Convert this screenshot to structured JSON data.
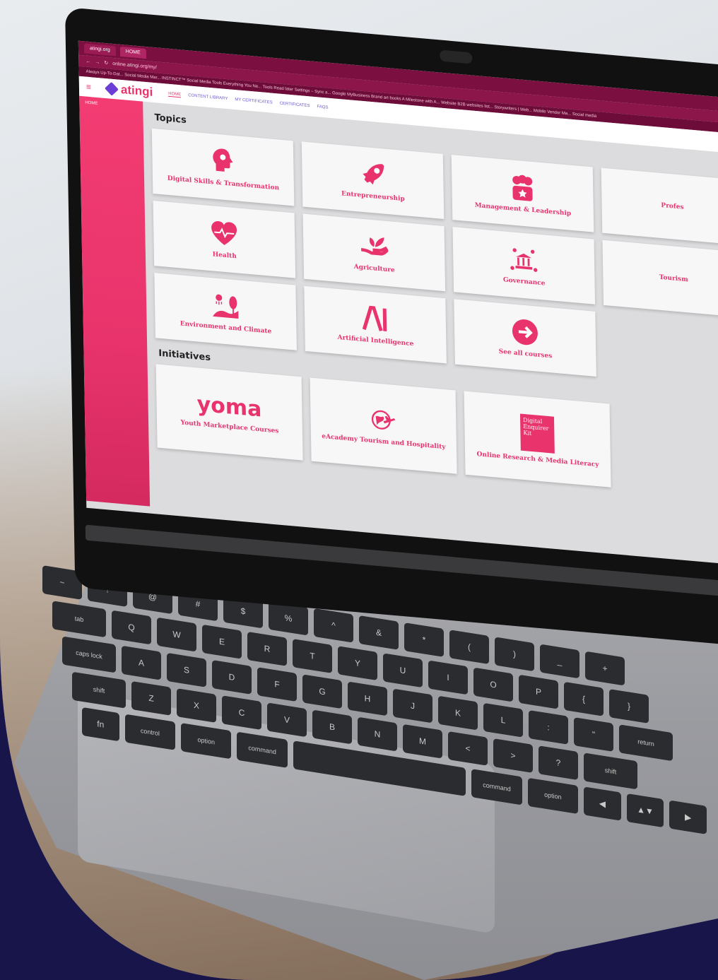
{
  "browser": {
    "tabs": [
      "atingi.org",
      "HOME"
    ],
    "url": "online.atingi.org/my/",
    "bookmarks": "Always Up-To-Dat...  Social Media Mar...  INSTINCT™  Social Media Tools  Everything You Ne...  Tools  Read later  Settings – Sync a...  Google MyBusiness  Brand art books  A Milestone with A...  Website  B2B websites list...  Storywriters | Web...  Mobile Vendor Ma...  Social media"
  },
  "app": {
    "brand": "atingi",
    "nav": [
      "HOME",
      "CONTENT LIBRARY",
      "MY CERTIFICATES",
      "CERTIFICATES",
      "FAQS"
    ],
    "sidebar_home": "HOME"
  },
  "topics": {
    "title": "Topics",
    "items": [
      {
        "label": "Digital Skills & Transformation",
        "icon": "brain-head-icon"
      },
      {
        "label": "Entrepreneurship",
        "icon": "rocket-icon"
      },
      {
        "label": "Management & Leadership",
        "icon": "team-star-icon"
      },
      {
        "label": "Profes",
        "icon": "partial-icon"
      },
      {
        "label": "Health",
        "icon": "heart-pulse-icon"
      },
      {
        "label": "Agriculture",
        "icon": "hand-plant-icon"
      },
      {
        "label": "Governance",
        "icon": "government-building-icon"
      },
      {
        "label": "Tourism",
        "icon": "partial-icon"
      },
      {
        "label": "Environment and Climate",
        "icon": "landscape-tree-icon"
      },
      {
        "label": "Artificial Intelligence",
        "icon": "ai-letters-icon"
      },
      {
        "label": "See all courses",
        "icon": "arrow-circle-icon"
      }
    ]
  },
  "initiatives": {
    "title": "Initiatives",
    "items": [
      {
        "logo": "yoma",
        "label": "Youth Marketplace Courses"
      },
      {
        "logo": "globe-plane",
        "label": "eAcademy Tourism and Hospitality"
      },
      {
        "logo": "Digital Enquirer Kit",
        "label": "Online Research & Media Literacy"
      }
    ]
  },
  "keyboard": {
    "rows": [
      [
        "~",
        "!",
        "@",
        "#",
        "$",
        "%",
        "^",
        "&",
        "*",
        "(",
        ")",
        "_",
        "+"
      ],
      [
        "tab",
        "Q",
        "W",
        "E",
        "R",
        "T",
        "Y",
        "U",
        "I",
        "O",
        "P",
        "{",
        "}"
      ],
      [
        "caps lock",
        "A",
        "S",
        "D",
        "F",
        "G",
        "H",
        "J",
        "K",
        "L",
        ":",
        "\"",
        "return"
      ],
      [
        "shift",
        "Z",
        "X",
        "C",
        "V",
        "B",
        "N",
        "M",
        "<",
        ">",
        "?",
        "shift"
      ],
      [
        "fn",
        "control",
        "option",
        "command",
        " ",
        "command",
        "option",
        "◀",
        "▲▼",
        "▶"
      ]
    ]
  },
  "colors": {
    "accent": "#e8336c",
    "sidebar": "#f23c72",
    "background": "#17154a"
  }
}
